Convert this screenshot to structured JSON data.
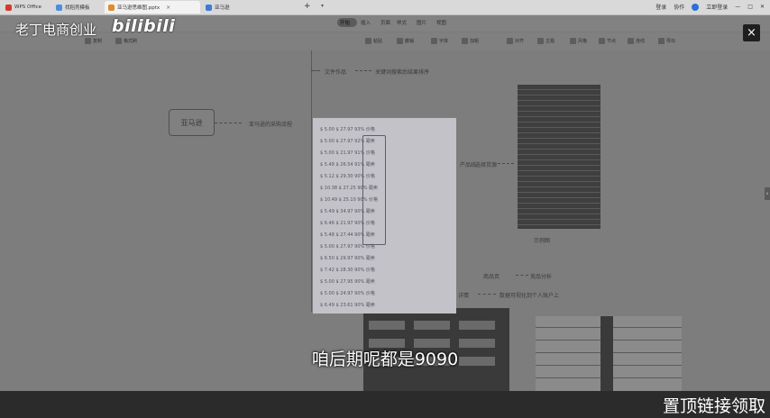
{
  "browser": {
    "tabs": [
      {
        "label": "WPS Office",
        "color": "#d33a2c"
      },
      {
        "label": "找稻壳模板",
        "color": "#4a8ee0"
      },
      {
        "label": "亚马逊思维图.pptx",
        "color": "#e08a2e"
      },
      {
        "label": "亚马逊",
        "color": "#3f7ad6"
      }
    ],
    "add_tab": "+",
    "dropdown": "▾",
    "right_items": [
      "登录",
      "协作",
      "分享"
    ],
    "login_label": "立即登录"
  },
  "menu": {
    "tabs": [
      "开始",
      "插入",
      "页面",
      "样式",
      "图片",
      "视图"
    ]
  },
  "ribbon": {
    "items": [
      "复制",
      "格式刷",
      "粘贴",
      "撤销",
      "字体",
      "加粗",
      "对齐",
      "主题",
      "风格",
      "节点",
      "连线",
      "导出"
    ]
  },
  "mindmap": {
    "root": "亚马逊",
    "branch_root": "亚马逊的采购流程",
    "top_branch_a": "文件作品",
    "top_branch_b": "关键词搜索后结果排序",
    "branch_mid": "产品线",
    "branch_mid_right": "选择货源",
    "image_caption": "示例图",
    "branch_low1_a": "商品页",
    "branch_low1_b": "竞品分析",
    "branch_low2_a": "详情",
    "branch_low2_b": "数据可视化到个人账户上"
  },
  "overlay": {
    "channel_name": "老丁电商创业",
    "platform": "bilibili",
    "close_icon": "×",
    "subtitle": "咱后期呢都是9090",
    "bottom_banner": "置顶链接领取",
    "side_arrow": "›"
  },
  "popup": {
    "rows": [
      "$ 5.00  $ 27.97   93%   价格",
      "$ 5.00  $ 27.97   92%   跟卖",
      "$ 5.00  $ 21.97   91%   价格",
      "$ 5.48  $ 26.54   91%   跟卖",
      "$ 5.12  $ 29.30   90%   价格",
      "$ 10.38 $ 27.25   90%   跟卖",
      "$ 10.49 $ 25.10   90%   价格",
      "$ 5.49  $ 34.97   90%   跟卖",
      "$ 6.46  $ 21.97   90%   价格",
      "$ 5.48  $ 27.44   90%   跟卖",
      "$ 5.00  $ 27.97   90%   价格",
      "$ 6.50  $ 29.97   90%   跟卖",
      "$ 7.42  $ 28.30   90%   价格",
      "$ 5.00  $ 27.95   90%   跟卖",
      "$ 5.00  $ 24.97   90%   价格",
      "$ 6.49  $ 23.61   90%   跟卖"
    ],
    "background": "#c2c2c8"
  }
}
